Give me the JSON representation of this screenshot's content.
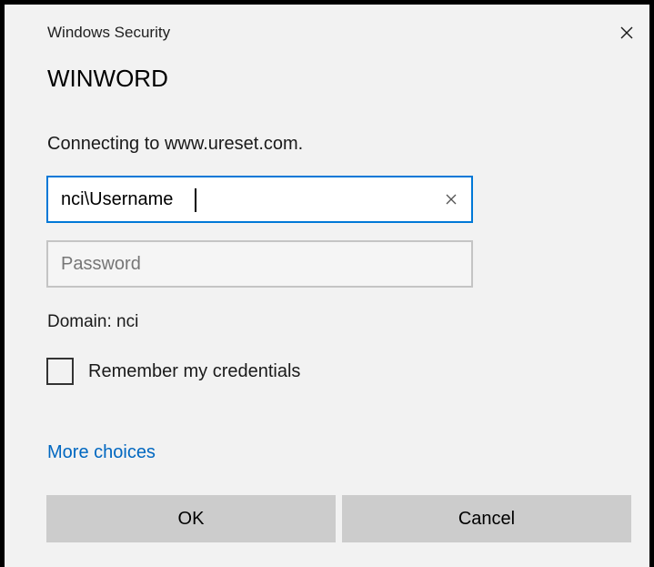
{
  "window": {
    "caption": "Windows Security",
    "app_name": "WINWORD",
    "close_icon": "close-icon"
  },
  "message": {
    "connecting": "Connecting to www.ureset.com."
  },
  "username": {
    "value": "nci\\Username",
    "clear_icon": "clear-icon"
  },
  "password": {
    "value": "",
    "placeholder": "Password"
  },
  "domain": {
    "text": "Domain: nci"
  },
  "remember": {
    "label": "Remember my credentials",
    "checked": false
  },
  "links": {
    "more_choices": "More choices"
  },
  "buttons": {
    "ok": "OK",
    "cancel": "Cancel"
  },
  "colors": {
    "focus_border": "#0078d7",
    "link": "#0067c0",
    "button_bg": "#cccccc",
    "dialog_bg": "#f2f2f2"
  }
}
